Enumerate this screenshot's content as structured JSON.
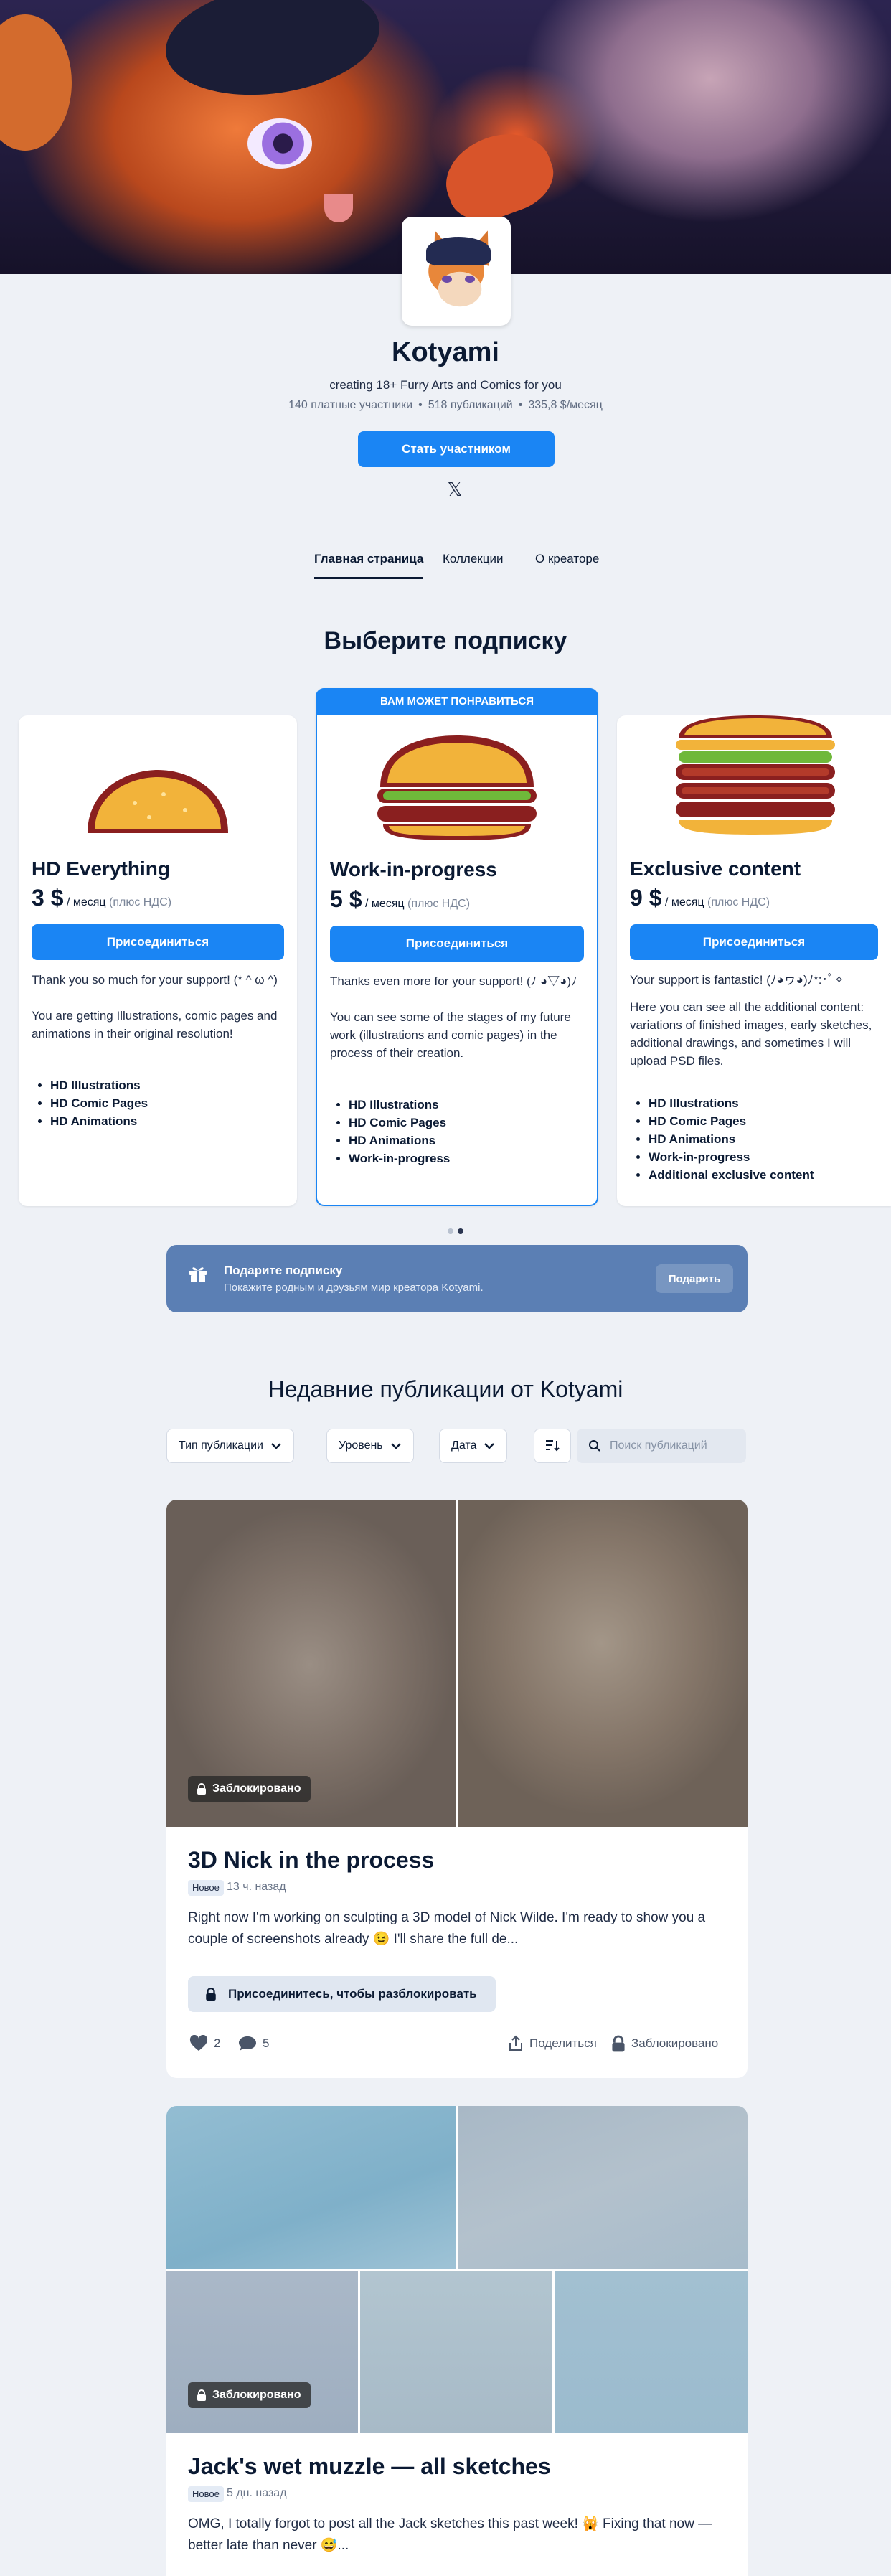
{
  "creator": {
    "name": "Kotyami",
    "tagline": "creating 18+ Furry Arts and Comics for you",
    "stats": [
      "140 платные участники",
      "518 публикаций",
      "335,8 $/месяц"
    ],
    "join_label": "Стать участником"
  },
  "tabs": [
    {
      "label": "Главная страница",
      "active": true
    },
    {
      "label": "Коллекции",
      "active": false
    },
    {
      "label": "О креаторе",
      "active": false
    }
  ],
  "tiers_section": {
    "title": "Выберите подписку",
    "featured_banner": "ВАМ МОЖЕТ ПОНРАВИТЬСЯ",
    "tiers": [
      {
        "title": "HD Everything",
        "price": "3 $",
        "period": "/ месяц",
        "vat": "(плюс НДС)",
        "button": "Присоединиться",
        "desc": [
          "Thank you so much for your support! (* ^ ω ^)",
          "You are getting Illustrations, comic pages and animations in their original resolution!"
        ],
        "benefits": [
          "HD Illustrations",
          "HD Comic Pages",
          "HD Animations"
        ]
      },
      {
        "title": "Work-in-progress",
        "price": "5 $",
        "period": "/ месяц",
        "vat": "(плюс НДС)",
        "button": "Присоединиться",
        "desc": [
          "Thanks even more for your support! (ﾉ ◕▽◕)ﾉ",
          "You can see some of the stages of my future work (illustrations and comic pages) in the process of their creation."
        ],
        "benefits": [
          "HD Illustrations",
          "HD Comic Pages",
          "HD Animations",
          "Work-in-progress"
        ]
      },
      {
        "title": "Exclusive content",
        "price": "9 $",
        "period": "/ месяц",
        "vat": "(плюс НДС)",
        "button": "Присоединиться",
        "desc": [
          "Your support is fantastic! (ﾉ◕ヮ◕)ﾉ*:･ﾟ✧",
          "Here you can see all the additional content: variations of finished images, early sketches, additional drawings, and sometimes I will upload PSD files."
        ],
        "benefits": [
          "HD Illustrations",
          "HD Comic Pages",
          "HD Animations",
          "Work-in-progress",
          "Additional exclusive content"
        ]
      }
    ],
    "carousel_page": 2,
    "carousel_pages": 2
  },
  "gift": {
    "title": "Подарите подписку",
    "subtitle": "Покажите родным и друзьям мир креатора Kotyami.",
    "button": "Подарить"
  },
  "posts_section": {
    "title": "Недавние публикации от Kotyami",
    "filters": [
      "Тип публикации",
      "Уровень",
      "Дата"
    ],
    "search_placeholder": "Поиск публикаций"
  },
  "posts": [
    {
      "locked_label": "Заблокировано",
      "title": "3D Nick in the process",
      "badge": "Новое",
      "time": "13 ч. назад",
      "text": "Right now I'm working on sculpting a 3D model of Nick Wilde. I'm ready to show you a couple of screenshots already 😉 I'll share the full de...",
      "unlock_label": "Присоединитесь, чтобы разблокировать",
      "likes": "2",
      "comments": "5",
      "share_label": "Поделиться",
      "status_label": "Заблокировано"
    },
    {
      "locked_label": "Заблокировано",
      "title": "Jack's wet muzzle — all sketches",
      "badge": "Новое",
      "time": "5 дн. назад",
      "text": "OMG, I totally forgot to post all the Jack sketches this past week! 🙀 Fixing that now — better late than never 😅..."
    }
  ],
  "colors": {
    "accent": "#1a85f4",
    "gift_bg": "#5b7fb4",
    "page_bg": "#eef1f6",
    "text": "#0b1a33"
  }
}
